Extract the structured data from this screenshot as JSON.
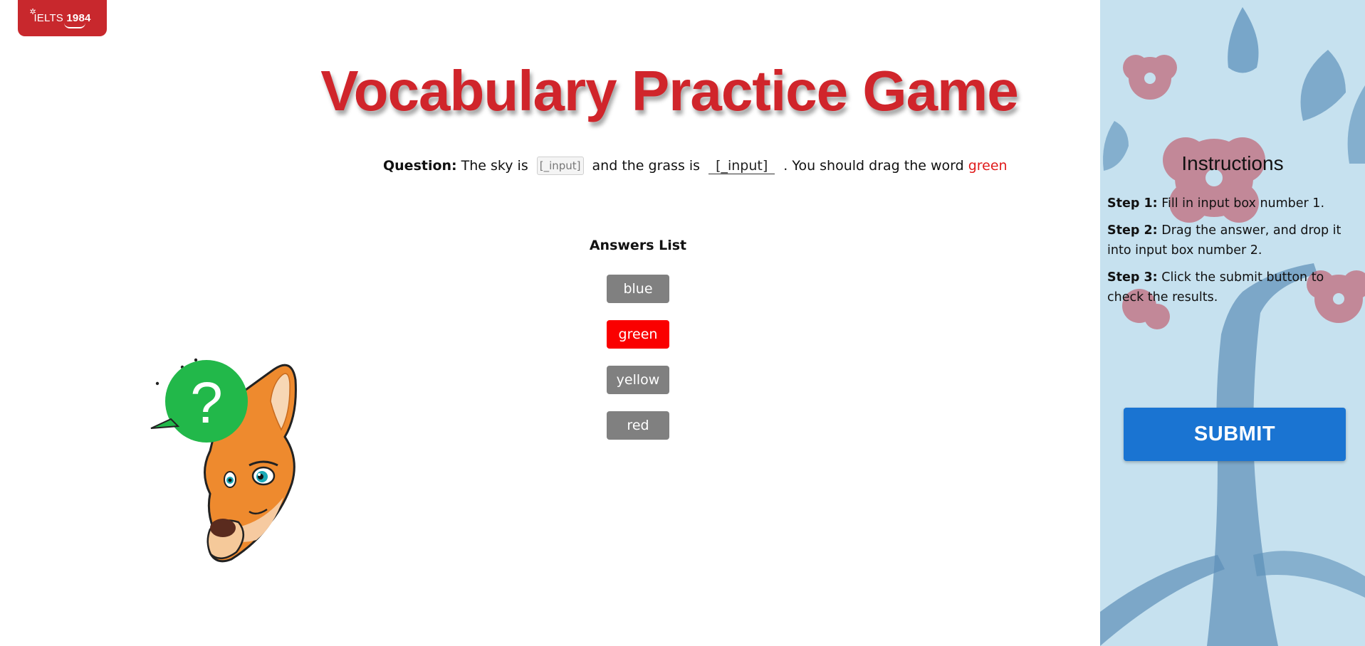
{
  "logo": {
    "text_plain": "IELTS",
    "text_bold": "1984"
  },
  "title": "Vocabulary Practice Game",
  "question": {
    "label": "Question:",
    "part1": "The sky is",
    "input1_placeholder": "[_input]",
    "part2": "and the grass is",
    "input2_text": "[_input]",
    "part3": ". You should drag the word",
    "highlight_word": "green",
    "highlight_color": "#e01a1a"
  },
  "answers": {
    "heading": "Answers List",
    "items": [
      {
        "label": "blue",
        "selected": false
      },
      {
        "label": "green",
        "selected": true
      },
      {
        "label": "yellow",
        "selected": false
      },
      {
        "label": "red",
        "selected": false
      }
    ],
    "default_color": "#808080",
    "selected_color": "#fa0000"
  },
  "mascot": {
    "icon": "kangaroo-question-mascot-icon",
    "symbol": "?"
  },
  "instructions": {
    "title": "Instructions",
    "steps": [
      {
        "label": "Step 1:",
        "text": "Fill in input box number 1."
      },
      {
        "label": "Step 2:",
        "text": "Drag the answer, and drop it into input box number 2."
      },
      {
        "label": "Step 3:",
        "text": "Click the submit button to check the results."
      }
    ]
  },
  "submit_label": "SUBMIT",
  "colors": {
    "brand_red": "#c8282d",
    "title_red": "#d0252b",
    "submit_blue": "#1a74d2",
    "panel_bg": "#c6e1ef"
  }
}
